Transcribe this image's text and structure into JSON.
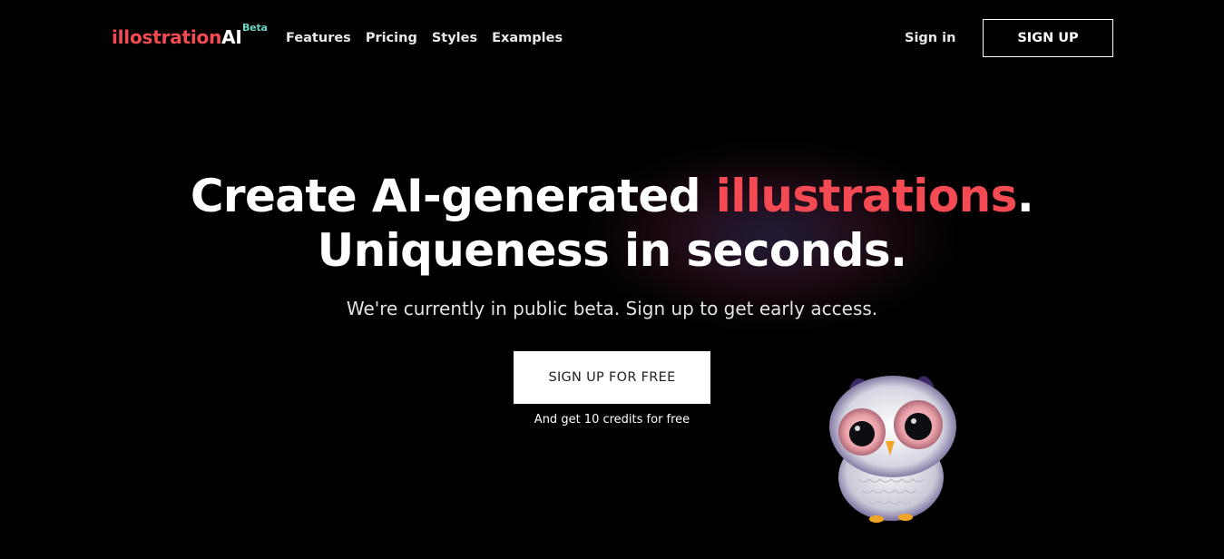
{
  "brand": {
    "name_part1": "illostration",
    "name_part2": "AI",
    "badge": "Beta",
    "color": "#f34a53",
    "badge_color": "#6ed6c4"
  },
  "nav": {
    "links": [
      "Features",
      "Pricing",
      "Styles",
      "Examples"
    ],
    "sign_in": "Sign in",
    "sign_up": "SIGN UP"
  },
  "hero": {
    "headline_start": "Create AI-generated ",
    "headline_accent": "illustrations",
    "headline_end": ".",
    "headline_line2": "Uniqueness in seconds.",
    "subline": "We're currently in public beta. Sign up to get early access.",
    "cta": "SIGN UP FOR FREE",
    "cta_note": "And get 10 credits for free",
    "accent_color": "#f34a53"
  },
  "illustration": {
    "icon": "owl-illustration"
  }
}
